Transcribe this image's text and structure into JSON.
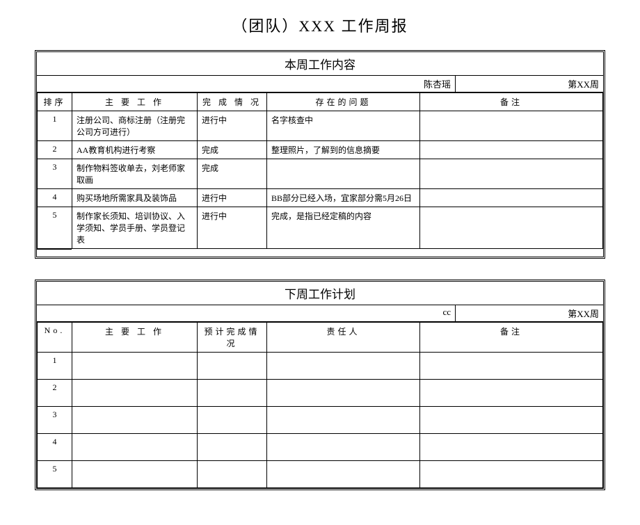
{
  "page_title": "（团队）XXX 工作周报",
  "section1": {
    "title": "本周工作内容",
    "meta_name": "陈杏瑶",
    "meta_week": "第XX周",
    "headers": {
      "num": "排序",
      "work": "主 要 工 作",
      "status": "完 成 情 况",
      "issue": "存在的问题",
      "note": "备注"
    },
    "rows": [
      {
        "num": "1",
        "work": "注册公司、商标注册（注册完公司方可进行）",
        "status": "进行中",
        "issue": "名字核查中",
        "note": ""
      },
      {
        "num": "2",
        "work": "AA教育机构进行考察",
        "status": "完成",
        "issue": "整理照片，了解到的信息摘要",
        "note": ""
      },
      {
        "num": "3",
        "work": "制作物料签收单去，刘老师家取画",
        "status": "完成",
        "issue": "",
        "note": ""
      },
      {
        "num": "4",
        "work": "购买场地所需家具及装饰品",
        "status": "进行中",
        "issue": "BB部分已经入场，宜家部分需5月26日",
        "note": ""
      },
      {
        "num": "5",
        "work": "制作家长须知、培训协议、入学须知、学员手册、学员登记表",
        "status": "进行中",
        "issue": "完成，是指已经定稿的内容",
        "note": ""
      }
    ]
  },
  "section2": {
    "title": "下周工作计划",
    "meta_name": "cc",
    "meta_week": "第XX周",
    "headers": {
      "num": "No.",
      "work": "主 要 工 作",
      "status": "预计完成情况",
      "owner": "责任人",
      "note": "备注"
    },
    "rows": [
      {
        "num": "1",
        "work": "",
        "status": "",
        "owner": "",
        "note": ""
      },
      {
        "num": "2",
        "work": "",
        "status": "",
        "owner": "",
        "note": ""
      },
      {
        "num": "3",
        "work": "",
        "status": "",
        "owner": "",
        "note": ""
      },
      {
        "num": "4",
        "work": "",
        "status": "",
        "owner": "",
        "note": ""
      },
      {
        "num": "5",
        "work": "",
        "status": "",
        "owner": "",
        "note": ""
      }
    ]
  }
}
